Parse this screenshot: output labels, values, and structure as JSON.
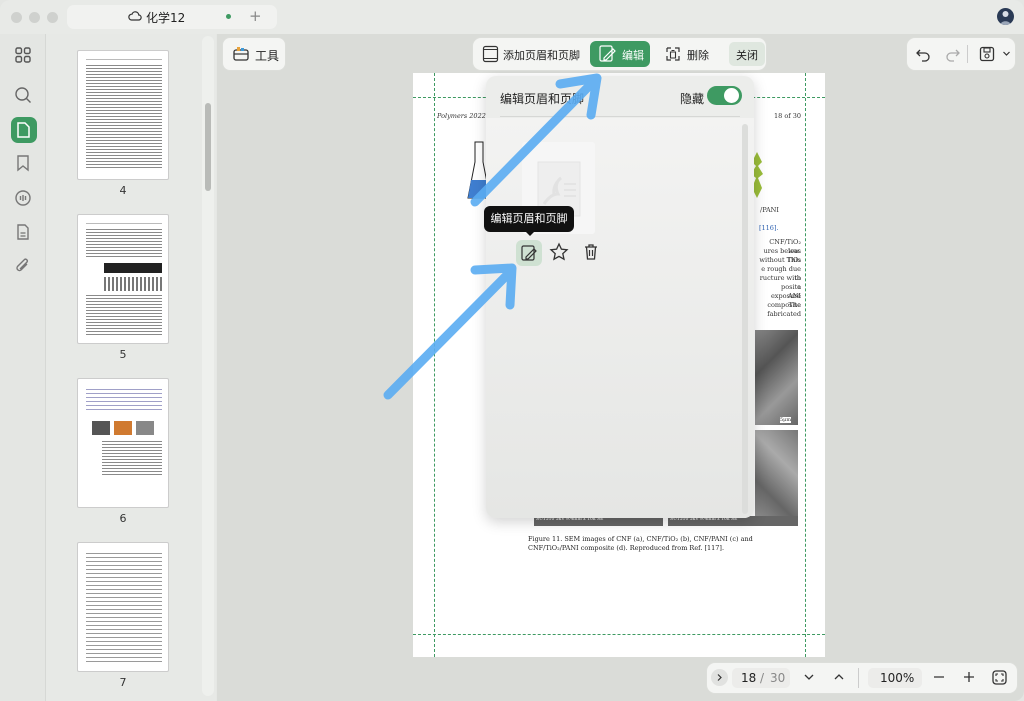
{
  "window": {
    "tab_title": "化学12"
  },
  "sidebar": {
    "icons": [
      "grid-icon",
      "search-icon",
      "page-icon",
      "bookmark-icon",
      "comment-icon",
      "document-icon",
      "attachment-icon"
    ]
  },
  "thumbnails": [
    {
      "label": "4"
    },
    {
      "label": "5"
    },
    {
      "label": "6"
    },
    {
      "label": "7"
    }
  ],
  "toolbar": {
    "tools_label": "工具",
    "add_header_footer": "添加页眉和页脚",
    "edit": "编辑",
    "delete": "删除",
    "close": "关闭"
  },
  "popup": {
    "title": "编辑页眉和页脚",
    "hide_label": "隐藏",
    "toggle_on": true,
    "tooltip": "编辑页眉和页脚"
  },
  "page": {
    "header_left": "Polymers 2022, 14, 4",
    "header_right": "18 of 30",
    "ref_116": "[116].",
    "right_col": [
      "CNF/TiO₂ was",
      "ures below. This",
      "without TiO₂",
      "e rough due to",
      "ructure with a",
      "posite exposure",
      "ANI composite",
      "The fabricated"
    ],
    "pani_label": "/PANI",
    "sem_label_1": "SU1510 5kV 9.4mm x 10k SE",
    "sem_label_2": "SU1510 5kV 9.4mm x 10k SE",
    "scale": "5μm",
    "caption": "Figure 11. SEM images of CNF (a), CNF/TiO₂ (b), CNF/PANI (c) and CNF/TiO₂/PANI composite (d). Reproduced from Ref. [117]."
  },
  "navigation": {
    "current_page": "18",
    "separator": "/",
    "total_pages": "30",
    "zoom": "100%"
  },
  "colors": {
    "accent": "#3e9a62",
    "arrow": "#4aa3f0"
  }
}
